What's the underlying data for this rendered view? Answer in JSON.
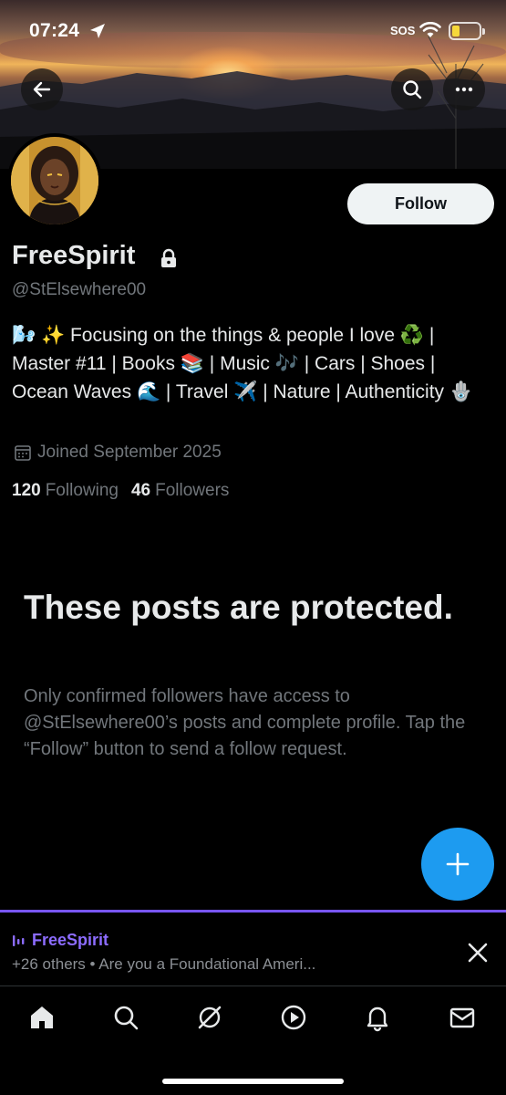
{
  "status_bar": {
    "time": "07:24",
    "sos": "SOS",
    "location_icon": "location-arrow-icon",
    "wifi_icon": "wifi-icon",
    "battery_icon": "battery-low-icon"
  },
  "header": {
    "back_icon": "back-arrow-icon",
    "search_icon": "search-icon",
    "more_icon": "more-dots-icon"
  },
  "profile": {
    "follow_label": "Follow",
    "display_name": "FreeSpirit",
    "handle": "@StElsewhere00",
    "bio": "🌬️ ✨ Focusing on the things & people I love ♻️ | Master #11 | Books 📚 | Music 🎶 | Cars | Shoes | Ocean Waves 🌊 | Travel ✈️ | Nature | Authenticity 🪬",
    "joined": "Joined September 2025",
    "following_count": "120",
    "following_label": "Following",
    "followers_count": "46",
    "followers_label": "Followers"
  },
  "protected": {
    "title": "These posts are protected.",
    "body": "Only confirmed followers have access to @StElsewhere00’s posts and complete profile. Tap the “Follow” button to send a follow request."
  },
  "spaces": {
    "title": "FreeSpirit",
    "subtitle": "+26 others • Are you a Foundational Ameri..."
  },
  "colors": {
    "accent": "#1d9bf0",
    "spaces_purple": "#7856ff",
    "muted_text": "#71767b",
    "primary_text": "#e7e9ea",
    "background": "#000000"
  },
  "tabbar": {
    "items": [
      {
        "name": "home-icon"
      },
      {
        "name": "search-icon"
      },
      {
        "name": "grok-icon"
      },
      {
        "name": "video-play-icon"
      },
      {
        "name": "notifications-bell-icon"
      },
      {
        "name": "messages-envelope-icon"
      }
    ]
  }
}
